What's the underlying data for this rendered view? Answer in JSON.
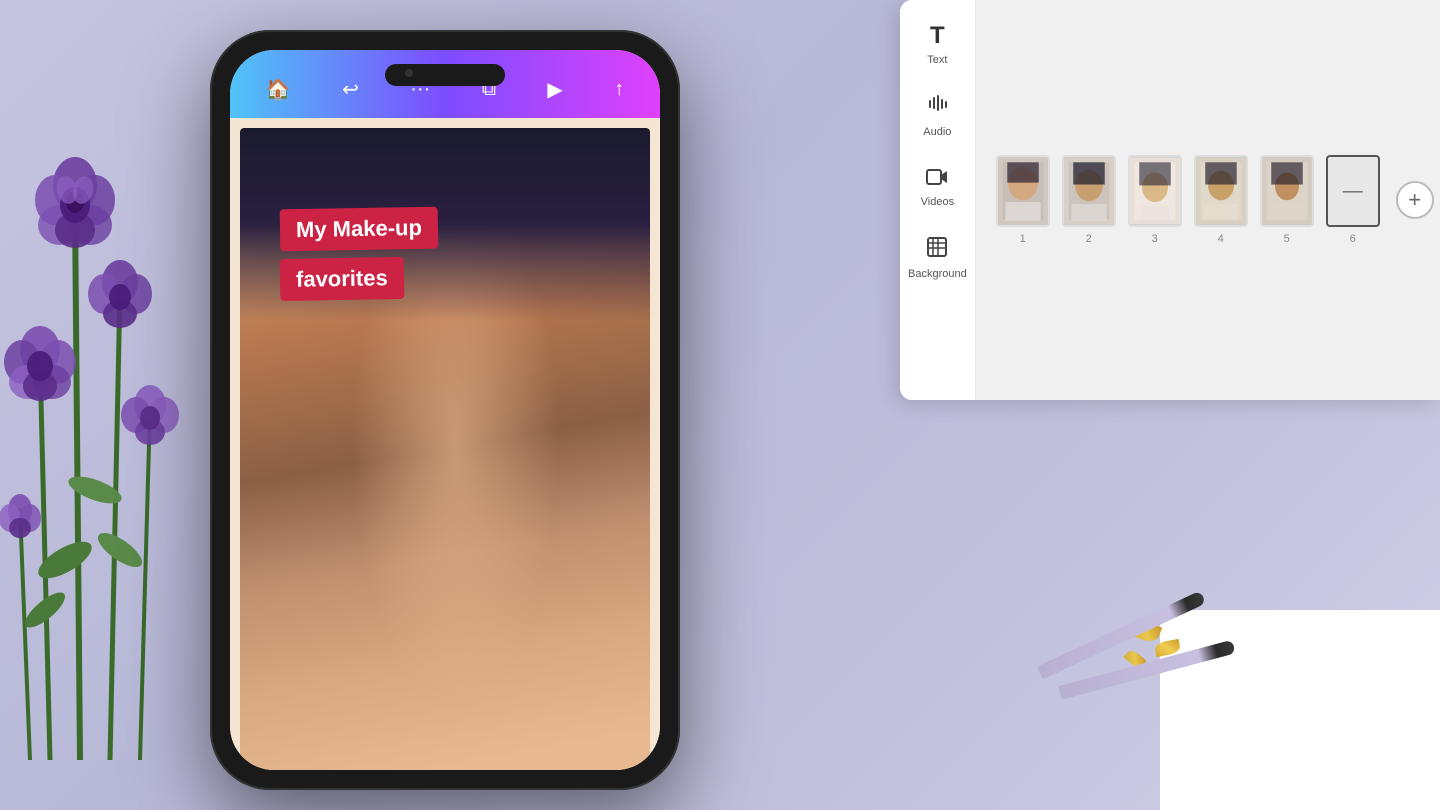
{
  "background": {
    "color": "#c5c5e0"
  },
  "phone": {
    "toolbar": {
      "icons": [
        "🏠",
        "↩",
        "···",
        "⧉",
        "▶",
        "↑"
      ]
    },
    "canvas": {
      "text1": "My Make-up",
      "text2": "favorites"
    }
  },
  "editor": {
    "sidebar": {
      "tools": [
        {
          "id": "text",
          "label": "Text",
          "icon": "T"
        },
        {
          "id": "audio",
          "label": "Audio",
          "icon": "♪"
        },
        {
          "id": "videos",
          "label": "Videos",
          "icon": "▶"
        },
        {
          "id": "background",
          "label": "Background",
          "icon": "▦"
        }
      ]
    },
    "slides": [
      {
        "num": "1",
        "active": false
      },
      {
        "num": "2",
        "active": false
      },
      {
        "num": "3",
        "active": false
      },
      {
        "num": "4",
        "active": false
      },
      {
        "num": "5",
        "active": false
      },
      {
        "num": "6",
        "active": true,
        "empty": true
      }
    ],
    "add_button_label": "+"
  }
}
